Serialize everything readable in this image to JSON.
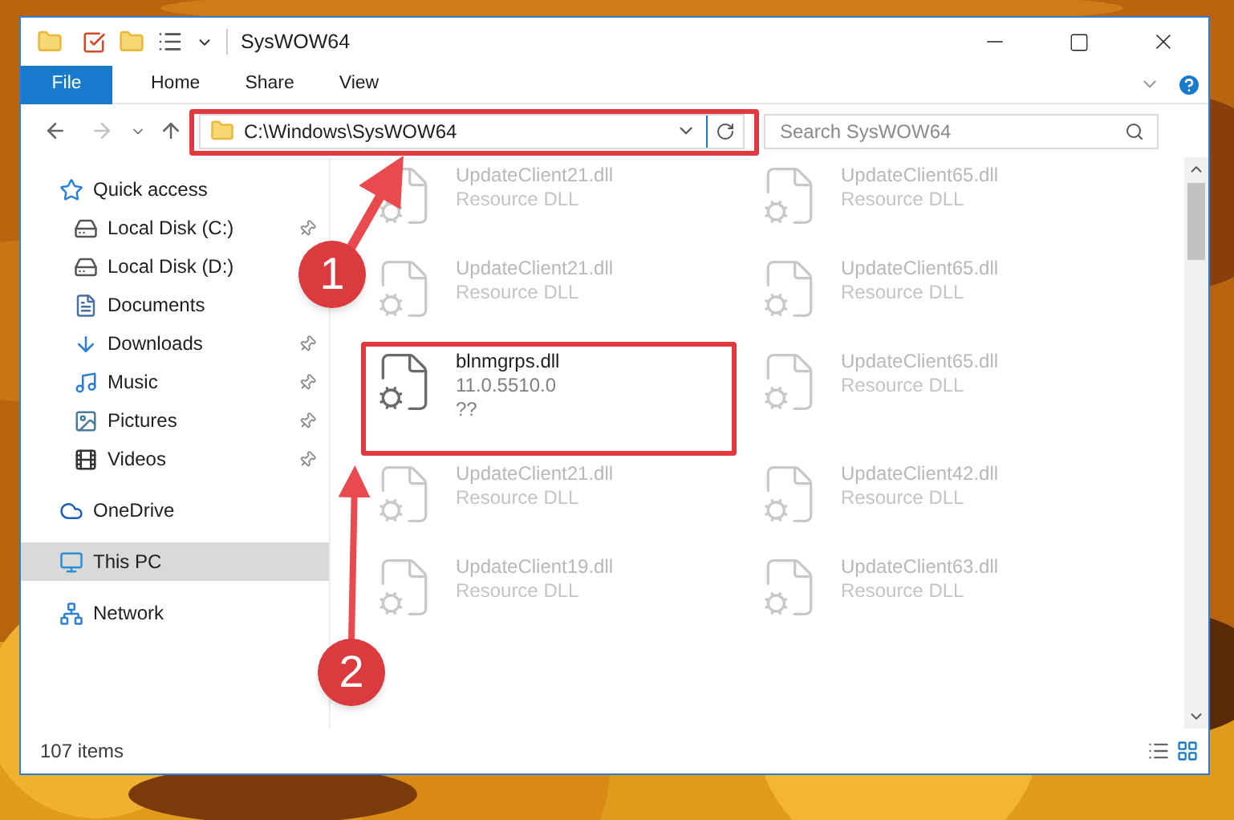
{
  "window": {
    "title": "SysWOW64"
  },
  "ribbon_tabs": [
    {
      "label": "File",
      "selected": true
    },
    {
      "label": "Home",
      "selected": false
    },
    {
      "label": "Share",
      "selected": false
    },
    {
      "label": "View",
      "selected": false
    }
  ],
  "address": {
    "path": "C:\\Windows\\SysWOW64"
  },
  "search": {
    "placeholder": "Search SysWOW64"
  },
  "sidebar": {
    "items": [
      {
        "label": "Quick access",
        "kind": "star",
        "selected": false,
        "pinned": false,
        "children": [
          {
            "label": "Local Disk (C:)",
            "kind": "drive",
            "selected": false,
            "pinned": true
          },
          {
            "label": "Local Disk (D:)",
            "kind": "drive",
            "selected": false,
            "pinned": false
          },
          {
            "label": "Documents",
            "kind": "document",
            "selected": false,
            "pinned": false
          },
          {
            "label": "Downloads",
            "kind": "download",
            "selected": false,
            "pinned": true
          },
          {
            "label": "Music",
            "kind": "music",
            "selected": false,
            "pinned": true
          },
          {
            "label": "Pictures",
            "selected": false,
            "pinned": true
          },
          {
            "label": "Videos",
            "kind": "video",
            "selected": false,
            "pinned": true
          }
        ]
      },
      {
        "label": "OneDrive",
        "kind": "cloud",
        "selected": false,
        "pinned": false
      },
      {
        "label": "This PC",
        "kind": "computer",
        "selected": true,
        "pinned": false
      },
      {
        "label": "Network",
        "kind": "network",
        "selected": false,
        "pinned": false
      }
    ]
  },
  "files": [
    {
      "name": "UpdateClient21.dll",
      "lines": [
        "Resource DLL"
      ],
      "faded": true
    },
    {
      "name": "UpdateClient65.dll",
      "lines": [
        "Resource DLL"
      ],
      "faded": true
    },
    {
      "name": "UpdateClient21.dll",
      "lines": [
        "Resource DLL"
      ],
      "faded": true
    },
    {
      "name": "UpdateClient65.dll",
      "lines": [
        "Resource DLL"
      ],
      "faded": true
    },
    {
      "name": "blnmgrps.dll",
      "lines": [
        "11.0.5510.0",
        "??"
      ],
      "faded": false
    },
    {
      "name": "UpdateClient65.dll",
      "lines": [
        "Resource DLL"
      ],
      "faded": true
    },
    {
      "name": "UpdateClient21.dll",
      "lines": [
        "Resource DLL"
      ],
      "faded": true
    },
    {
      "name": "UpdateClient42.dll",
      "lines": [
        "Resource DLL"
      ],
      "faded": true
    },
    {
      "name": "UpdateClient19.dll",
      "lines": [
        "Resource DLL"
      ],
      "faded": true
    },
    {
      "name": "UpdateClient63.dll",
      "lines": [
        "Resource DLL"
      ],
      "faded": true
    }
  ],
  "status_bar": {
    "count": "107 items"
  },
  "annotations": [
    {
      "number": "1"
    },
    {
      "number": "2"
    }
  ]
}
